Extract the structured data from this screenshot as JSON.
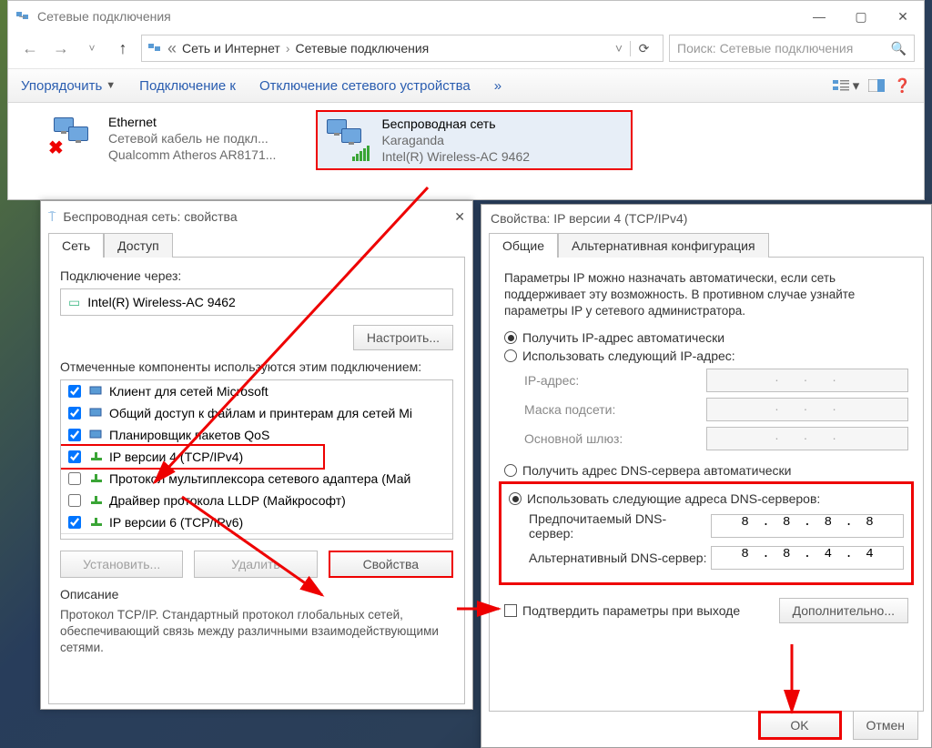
{
  "mainWindow": {
    "title": "Сетевые подключения",
    "breadcrumb": {
      "p1": "Сеть и Интернет",
      "p2": "Сетевые подключения"
    },
    "search_placeholder": "Поиск: Сетевые подключения",
    "toolbar": {
      "organize": "Упорядочить",
      "connect": "Подключение к",
      "disable": "Отключение сетевого устройства",
      "more": "»"
    },
    "connections": [
      {
        "name": "Ethernet",
        "status": "Сетевой кабель не подкл...",
        "adapter": "Qualcomm Atheros AR8171..."
      },
      {
        "name": "Беспроводная сеть",
        "status": "Karaganda",
        "adapter": "Intel(R) Wireless-AC 9462"
      }
    ]
  },
  "dlg1": {
    "title": "Беспроводная сеть: свойства",
    "tabs": {
      "net": "Сеть",
      "access": "Доступ"
    },
    "connect_via_label": "Подключение через:",
    "adapter": "Intel(R) Wireless-AC 9462",
    "configure": "Настроить...",
    "components_label": "Отмеченные компоненты используются этим подключением:",
    "components": [
      {
        "checked": true,
        "ic": "mon",
        "label": "Клиент для сетей Microsoft"
      },
      {
        "checked": true,
        "ic": "mon",
        "label": "Общий доступ к файлам и принтерам для сетей Mi"
      },
      {
        "checked": true,
        "ic": "mon",
        "label": "Планировщик пакетов QoS"
      },
      {
        "checked": true,
        "ic": "net",
        "label": "IP версии 4 (TCP/IPv4)",
        "selected": true
      },
      {
        "checked": false,
        "ic": "net",
        "label": "Протокол мультиплексора сетевого адаптера (Май"
      },
      {
        "checked": false,
        "ic": "net",
        "label": "Драйвер протокола LLDP (Майкрософт)"
      },
      {
        "checked": true,
        "ic": "net",
        "label": "IP версии 6 (TCP/IPv6)"
      }
    ],
    "buttons": {
      "install": "Установить...",
      "remove": "Удалить",
      "props": "Свойства"
    },
    "desc_label": "Описание",
    "desc": "Протокол TCP/IP. Стандартный протокол глобальных сетей, обеспечивающий связь между различными взаимодействующими сетями."
  },
  "dlg2": {
    "title": "Свойства: IP версии 4 (TCP/IPv4)",
    "tabs": {
      "general": "Общие",
      "alt": "Альтернативная конфигурация"
    },
    "intro": "Параметры IP можно назначать автоматически, если сеть поддерживает эту возможность. В противном случае узнайте параметры IP у сетевого администратора.",
    "ip": {
      "auto": "Получить IP-адрес автоматически",
      "manual": "Использовать следующий IP-адрес:",
      "f1": "IP-адрес:",
      "f2": "Маска подсети:",
      "f3": "Основной шлюз:"
    },
    "dns": {
      "auto": "Получить адрес DNS-сервера автоматически",
      "manual": "Использовать следующие адреса DNS-серверов:",
      "f1": "Предпочитаемый DNS-сервер:",
      "f2": "Альтернативный DNS-сервер:",
      "v1": "8 . 8 . 8 . 8",
      "v2": "8 . 8 . 4 . 4"
    },
    "confirm": "Подтвердить параметры при выходе",
    "advanced": "Дополнительно...",
    "ok": "OK",
    "cancel": "Отмен"
  }
}
